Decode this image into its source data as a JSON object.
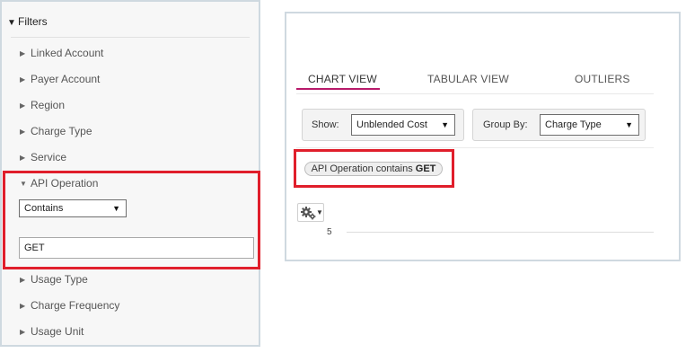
{
  "filters": {
    "header": "Filters",
    "items_top": [
      {
        "label": "Linked Account"
      },
      {
        "label": "Payer Account"
      },
      {
        "label": "Region"
      },
      {
        "label": "Charge Type"
      },
      {
        "label": "Service"
      }
    ],
    "api_operation": {
      "label": "API Operation",
      "operator_value": "Contains",
      "input_value": "GET"
    },
    "items_bottom": [
      {
        "label": "Usage Type"
      },
      {
        "label": "Charge Frequency"
      },
      {
        "label": "Usage Unit"
      }
    ]
  },
  "chart_panel": {
    "tabs": [
      {
        "label": "CHART VIEW",
        "active": true
      },
      {
        "label": "TABULAR VIEW",
        "active": false
      },
      {
        "label": "OUTLIERS",
        "active": false
      }
    ],
    "show_label": "Show:",
    "show_value": "Unblended Cost",
    "group_by_label": "Group By:",
    "group_by_value": "Charge Type",
    "active_filter": {
      "prefix": "API Operation contains",
      "value": "GET"
    },
    "y_axis_tick": "5"
  },
  "icons": {
    "collapse": "triangle-down-icon",
    "expand": "triangle-right-icon",
    "dropdown": "caret-down-icon",
    "settings": "gear-icon"
  },
  "colors": {
    "highlight": "#e01e2b",
    "tab_active_underline": "#b81a6a",
    "panel_border": "#cfd9e0"
  }
}
